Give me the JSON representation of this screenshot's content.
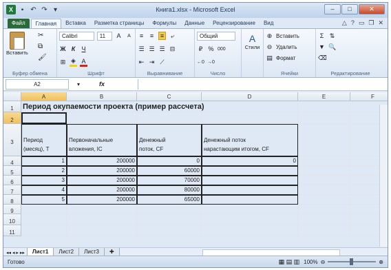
{
  "window": {
    "title": "Книга1.xlsx - Microsoft Excel",
    "logo": "X"
  },
  "tabs": [
    "Файл",
    "Главная",
    "Вставка",
    "Разметка страницы",
    "Формулы",
    "Данные",
    "Рецензирование",
    "Вид"
  ],
  "ribbon": {
    "clipboard": {
      "paste": "Вставить",
      "label": "Буфер обмена"
    },
    "font": {
      "name": "Calibri",
      "size": "11",
      "bold": "Ж",
      "italic": "К",
      "underline": "Ч",
      "grow": "A",
      "shrink": "A",
      "fontcolor": "A",
      "label": "Шрифт"
    },
    "alignment": {
      "label": "Выравнивание"
    },
    "number": {
      "format": "Общий",
      "percent": "%",
      "thousands": "000",
      "label": "Число"
    },
    "styles": {
      "button": "Стили"
    },
    "cells": {
      "insert": "Вставить",
      "delete": "Удалить",
      "format": "Формат",
      "label": "Ячейки"
    },
    "editing": {
      "sum": "Σ",
      "label": "Редактирование"
    }
  },
  "formula_bar": {
    "name_box": "A2",
    "fx": "fx",
    "value": ""
  },
  "columns": [
    "A",
    "B",
    "C",
    "D",
    "E",
    "F"
  ],
  "rows": [
    "1",
    "2",
    "3",
    "4",
    "5",
    "6",
    "7",
    "8",
    "9",
    "10",
    "11"
  ],
  "sheet": {
    "title": "Период окупаемости проекта (пример рассчета)",
    "headers": {
      "a": [
        "Период",
        "(месяц), Т"
      ],
      "b": [
        "Первоначальные",
        "вложения, IC"
      ],
      "c": [
        "Денежный",
        "поток, CF"
      ],
      "d": [
        "Денежный поток",
        "нарастающим итогом, CF"
      ]
    },
    "data": [
      {
        "period": "1",
        "ic": "200000",
        "cf": "0",
        "cum": "0"
      },
      {
        "period": "2",
        "ic": "200000",
        "cf": "60000",
        "cum": ""
      },
      {
        "period": "3",
        "ic": "200000",
        "cf": "70000",
        "cum": ""
      },
      {
        "period": "4",
        "ic": "200000",
        "cf": "80000",
        "cum": ""
      },
      {
        "period": "5",
        "ic": "200000",
        "cf": "65000",
        "cum": ""
      }
    ]
  },
  "sheet_tabs": [
    "Лист1",
    "Лист2",
    "Лист3"
  ],
  "status": {
    "ready": "Готово",
    "zoom": "100%"
  }
}
